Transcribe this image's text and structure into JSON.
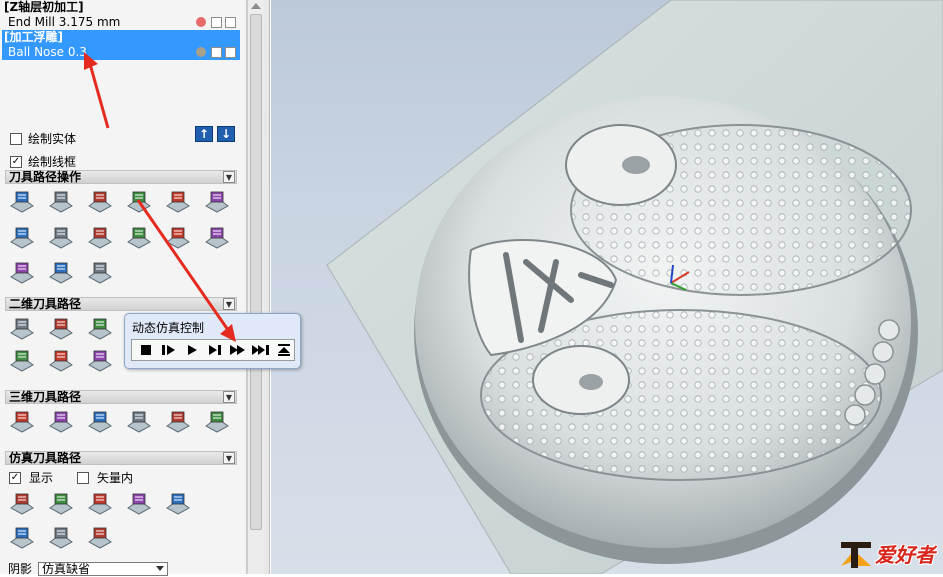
{
  "tree": {
    "group1": "[Z轴层初加工]",
    "item1": "End Mill 3.175 mm",
    "group2": "[加工浮雕]",
    "item2": "Ball Nose 0.3"
  },
  "options": {
    "draw_solid": "绘制实体",
    "draw_wireframe": "绘制线框",
    "draw_solid_checked": false,
    "draw_wireframe_checked": true
  },
  "sections": {
    "toolpath_ops": "刀具路径操作",
    "toolpaths_2d": "二维刀具路径",
    "toolpaths_3d": "三维刀具路径",
    "sim_toolpaths": "仿真刀具路径"
  },
  "sim_options": {
    "show": "显示",
    "vector_inside": "矢量内",
    "show_checked": true,
    "vector_inside_checked": false
  },
  "bottom": {
    "label": "阴影",
    "value": "仿真缺省"
  },
  "sim_popup": {
    "title": "动态仿真控制",
    "buttons": [
      "stop-icon",
      "step-play-icon",
      "play-icon",
      "step-forward-icon",
      "fast-forward-icon",
      "skip-end-icon",
      "eject-icon"
    ]
  },
  "watermark": {
    "text": "爱好者"
  },
  "colors": {
    "selection": "#3399ff",
    "annotation_arrow": "#e52b1f",
    "viewport_bg": "#c9d4e2",
    "relief": "#d9dedf"
  }
}
